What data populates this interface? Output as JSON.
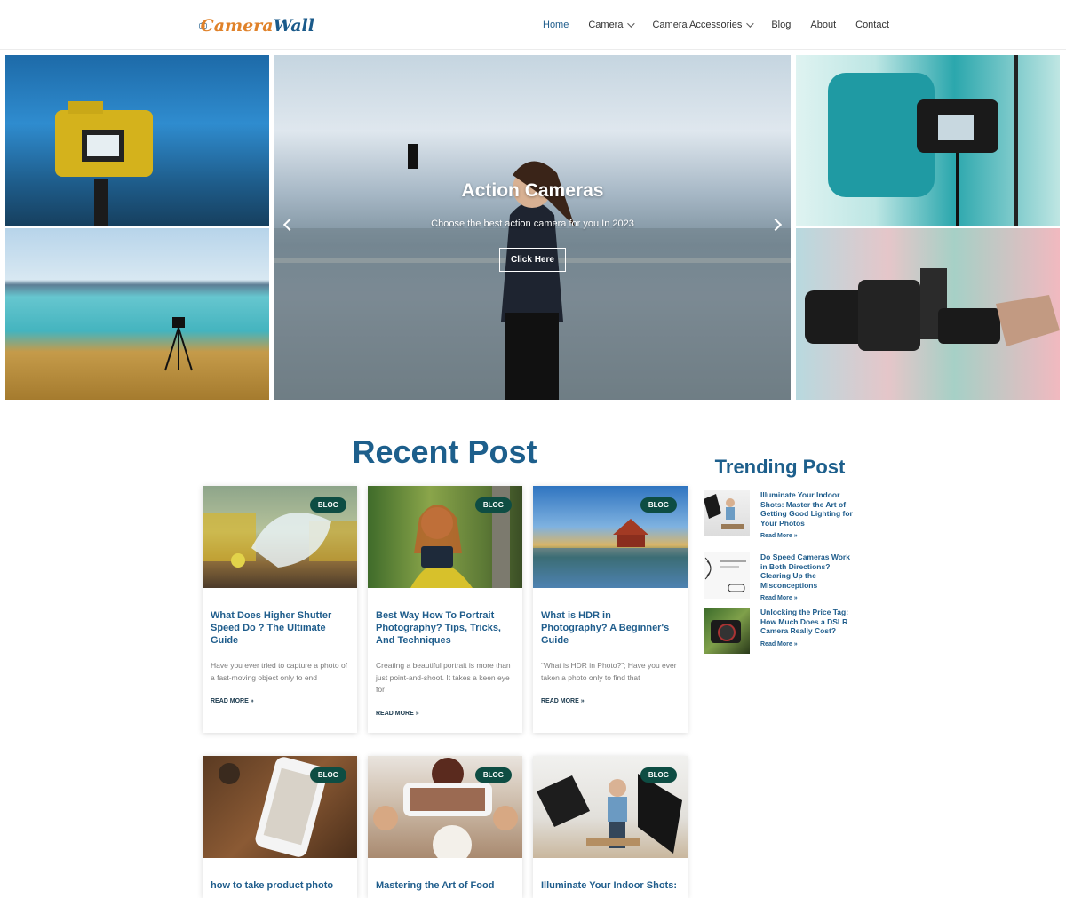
{
  "brand": {
    "logo_part1": "Camera",
    "logo_part2": "Wall"
  },
  "nav": {
    "items": [
      {
        "label": "Home"
      },
      {
        "label": "Camera"
      },
      {
        "label": "Camera Accessories"
      },
      {
        "label": "Blog"
      },
      {
        "label": "About"
      },
      {
        "label": "Contact"
      }
    ]
  },
  "hero": {
    "title": "Action Cameras",
    "subtitle": "Choose the best action camera for you In 2023",
    "button_label": "Click Here"
  },
  "recent": {
    "heading": "Recent Post",
    "posts": [
      {
        "badge": "BLOG",
        "title": "What Does Higher Shutter Speed Do ? The Ultimate Guide",
        "excerpt": "Have you ever tried to capture a photo of a fast-moving object only to end",
        "more": "READ MORE »"
      },
      {
        "badge": "BLOG",
        "title": "Best Way How To Portrait Photography? Tips, Tricks, And Techniques",
        "excerpt": "Creating a beautiful portrait is more than just point-and-shoot. It takes a keen eye for",
        "more": "READ MORE »"
      },
      {
        "badge": "BLOG",
        "title": "What is HDR in Photography? A Beginner's Guide",
        "excerpt": "“What is HDR in Photo?”; Have you ever taken a photo only to find that",
        "more": "READ MORE »"
      },
      {
        "badge": "BLOG",
        "title": "how to take product photo"
      },
      {
        "badge": "BLOG",
        "title": "Mastering the Art of Food"
      },
      {
        "badge": "BLOG",
        "title": "Illuminate Your Indoor Shots:"
      }
    ]
  },
  "trending": {
    "heading": "Trending Post",
    "items": [
      {
        "title": "Illuminate Your Indoor Shots: Master the Art of Getting Good Lighting for Your Photos",
        "more": "Read More »"
      },
      {
        "title": "Do Speed Cameras Work in Both Directions? Clearing Up the Misconceptions",
        "more": "Read More »"
      },
      {
        "title": "Unlocking the Price Tag: How Much Does a DSLR Camera Really Cost?",
        "more": "Read More »"
      }
    ]
  },
  "colors": {
    "accent": "#1f5d8c",
    "badge": "#0e4d43",
    "logo_orange": "#e0822a"
  }
}
